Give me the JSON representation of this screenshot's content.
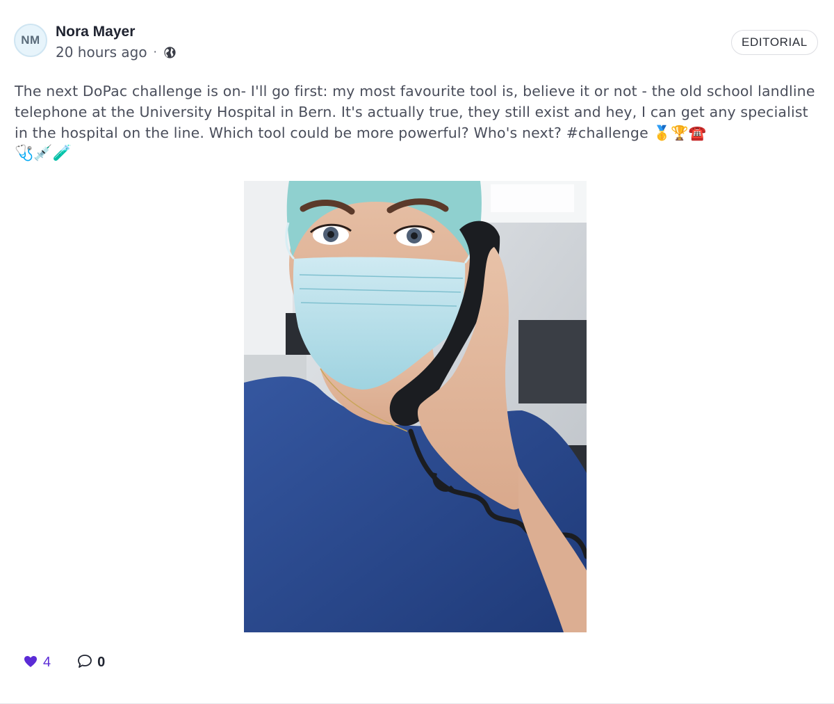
{
  "post": {
    "author": {
      "initials": "NM",
      "name": "Nora Mayer"
    },
    "timestamp": "20 hours ago",
    "separator": "·",
    "visibility_icon": "globe-icon",
    "badge": "EDITORIAL",
    "text": "The next DoPac challenge is on- I'll go first: my most favourite tool is, believe it or not - the old school landline telephone at the University Hospital in Bern. It's actually true, they still exist and hey, I can get any specialist in the hospital on the line. Which tool could be more powerful? Who's next? #challenge 🥇🏆☎️",
    "text_line2_emojis": "🩺💉🧪",
    "image": "photo-icon",
    "reactions": {
      "like_icon": "heart-icon",
      "likes": "4",
      "comment_icon": "speech-bubble-icon",
      "comments": "0"
    }
  },
  "colors": {
    "accent": "#5b2bd6",
    "text": "#4a4e5b",
    "name": "#1f2330",
    "avatar_bg": "#e7f4fb",
    "scrubs": "#2c4a8a",
    "cap": "#8fd0cf"
  }
}
